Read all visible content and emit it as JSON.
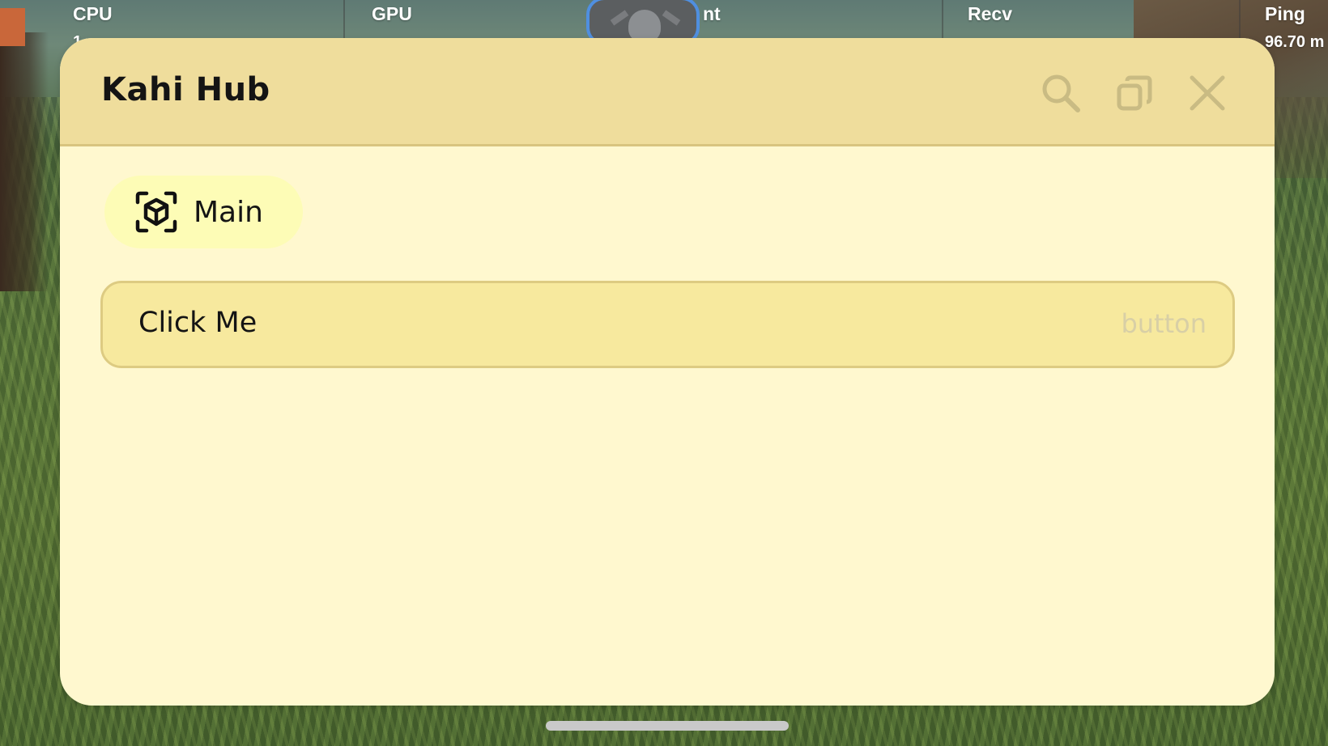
{
  "stats": [
    {
      "label": "CPU",
      "value": "1"
    },
    {
      "label": "GPU",
      "value": ""
    },
    {
      "label": "nt",
      "value": ""
    },
    {
      "label": "Recv",
      "value": ""
    },
    {
      "label": "Ping",
      "value": "96.70 m"
    }
  ],
  "window": {
    "title": "Kahi Hub",
    "controls": {
      "search_icon": "search-icon",
      "restore_icon": "restore-icon",
      "close_icon": "close-icon"
    }
  },
  "tabs": [
    {
      "label": "Main",
      "icon": "cube-scan-icon",
      "selected": true
    }
  ],
  "elements": [
    {
      "title": "Click Me",
      "kind": "button"
    }
  ],
  "colors": {
    "window_bg": "#fff8cf",
    "titlebar_bg": "#efdd9c",
    "tab_bg": "#fdfcb6",
    "button_bg": "#f7e99e",
    "button_border": "#ddcb82",
    "kind_text": "#d8cfa6",
    "avatar_ring": "#4f8fe0"
  }
}
